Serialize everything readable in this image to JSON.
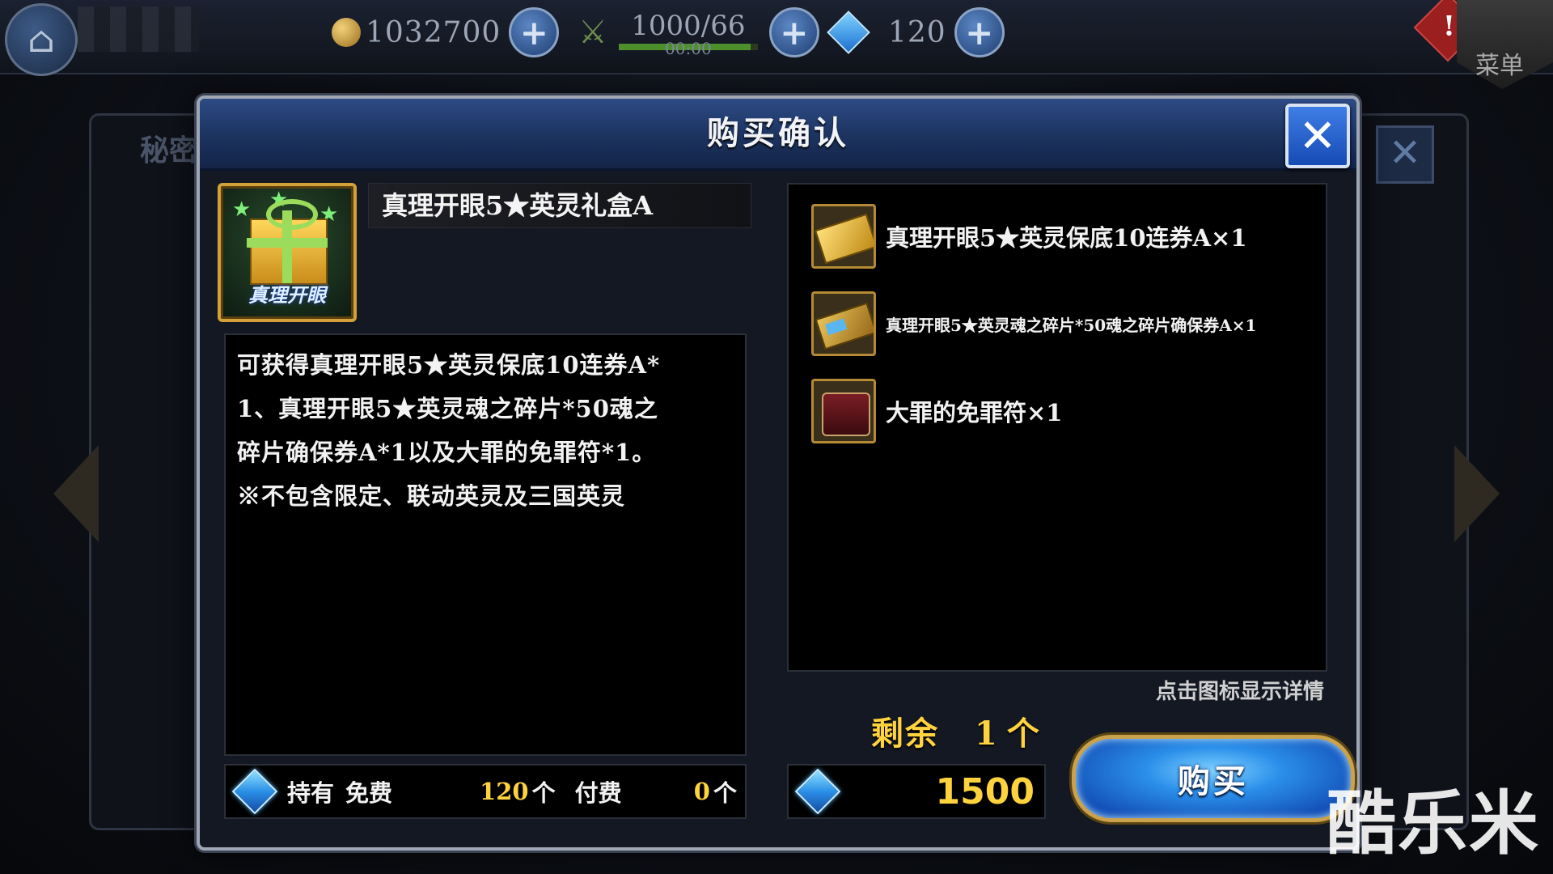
{
  "topbar": {
    "gold": "1032700",
    "stamina": "1000/66",
    "stamina_timer": "00:00",
    "stamina_fraction": 0.95,
    "gems": "120",
    "menu_label": "菜单",
    "alert": "!"
  },
  "background": {
    "panel_title": "秘密"
  },
  "dialog": {
    "title": "购买确认",
    "item_name": "真理开眼5★英灵礼盒A",
    "item_icon_label": "真理开眼",
    "description": "可获得真理开眼5★英灵保底10连券A*\n1、真理开眼5★英灵魂之碎片*50魂之\n碎片确保券A*1以及大罪的免罪符*1。\n※不包含限定、联动英灵及三国英灵",
    "rewards": [
      {
        "label": "真理开眼5★英灵保底10连券A×1",
        "icon": "ticket-icon"
      },
      {
        "label": "真理开眼5★英灵魂之碎片*50魂之碎片确保券A×1",
        "icon": "soul-shard-ticket-icon"
      },
      {
        "label": "大罪的免罪符×1",
        "icon": "scroll-icon"
      }
    ],
    "hint": "点击图标显示详情",
    "remaining_label": "剩余",
    "remaining_count": "1",
    "remaining_unit": "个",
    "holdings": {
      "label": "持有",
      "free_label": "免费",
      "free_value": "120",
      "paid_label": "付费",
      "paid_value": "0",
      "unit": "个"
    },
    "price": "1500",
    "buy_label": "购买"
  },
  "watermark": "酷乐米"
}
